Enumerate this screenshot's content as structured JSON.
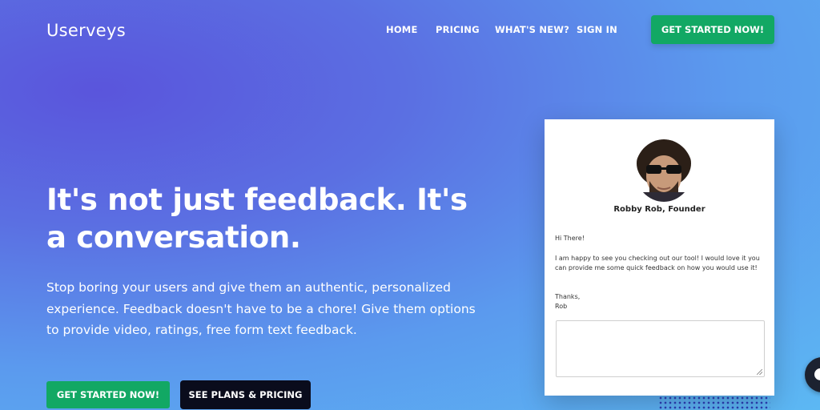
{
  "header": {
    "logo": "Userveys",
    "nav": [
      "HOME",
      "PRICING",
      "WHAT'S NEW?",
      "SIGN IN"
    ],
    "cta_label": "GET STARTED NOW!"
  },
  "hero": {
    "headline": "It's not just feedback. It's a conversation.",
    "subtitle": "Stop boring your users and give them an authentic, personalized experience. Feedback doesn't have to be a chore! Give them options to provide video, ratings, free form text feedback.",
    "primary_button": "GET STARTED NOW!",
    "secondary_button": "SEE PLANS & PRICING"
  },
  "card": {
    "founder_name": "Robby Rob, Founder",
    "greeting": "Hi There!",
    "body": "I am happy to see you checking out our tool! I would love it you can provide me some quick feedback on how you would use it!",
    "closing": "Thanks,",
    "signature": "Rob"
  },
  "colors": {
    "green": "#12a864",
    "dark_button": "#0a0c1c",
    "gradient_start": "#5a55dc",
    "gradient_end": "#5cb8f3"
  },
  "icons": {
    "chat_widget": "chat-bubble-icon"
  }
}
